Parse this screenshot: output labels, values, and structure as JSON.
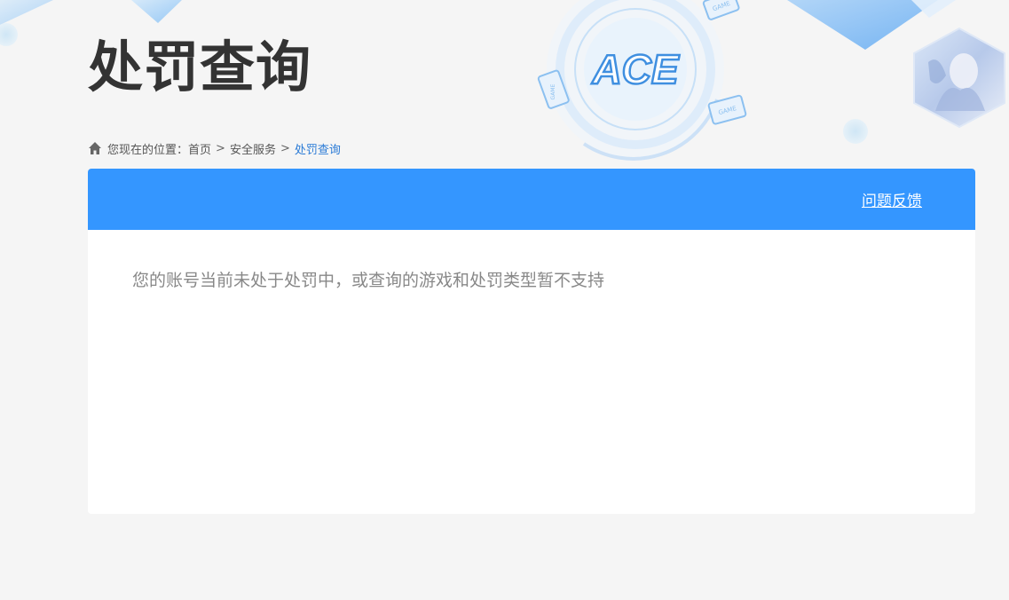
{
  "header": {
    "title": "处罚查询",
    "logo_text": "ACE",
    "badge_text": "GAME"
  },
  "breadcrumb": {
    "prefix": "您现在的位置：",
    "items": [
      "首页",
      "安全服务",
      "处罚查询"
    ],
    "separator": ">"
  },
  "panel": {
    "feedback_label": "问题反馈",
    "message": "您的账号当前未处于处罚中，或查询的游戏和处罚类型暂不支持"
  },
  "colors": {
    "accent": "#3496ff",
    "title": "#333333",
    "breadcrumb_current": "#2b7bd6",
    "message": "#888888"
  }
}
